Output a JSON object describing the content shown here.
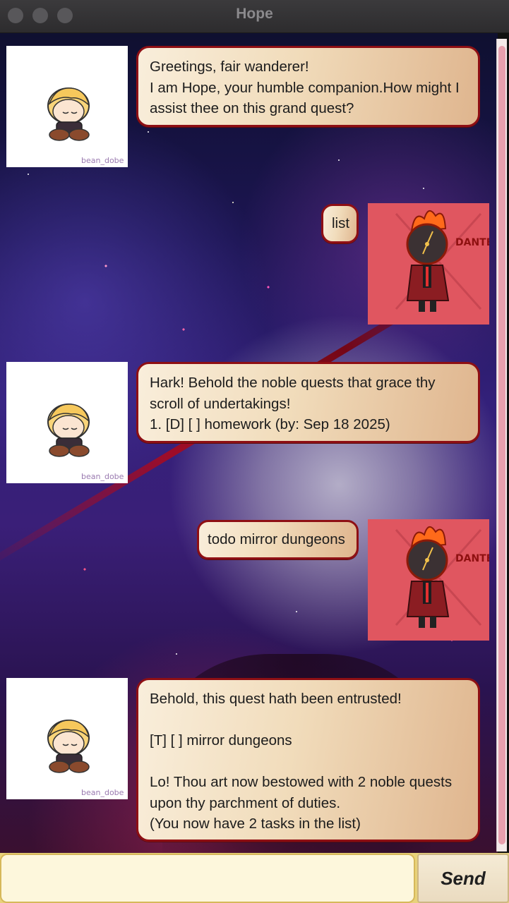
{
  "window": {
    "title": "Hope"
  },
  "messages": [
    {
      "sender": "bot",
      "avatar": "hope-chibi",
      "text": "Greetings, fair wanderer!\nI am Hope, your humble companion.How might I assist thee on this grand quest?"
    },
    {
      "sender": "user",
      "avatar": "dante-clock-head",
      "text": "list"
    },
    {
      "sender": "bot",
      "avatar": "hope-chibi",
      "text": "Hark! Behold the noble quests that grace thy scroll of undertakings!\n1. [D] [ ] homework (by: Sep 18 2025)"
    },
    {
      "sender": "user",
      "avatar": "dante-clock-head",
      "text": "todo mirror dungeons"
    },
    {
      "sender": "bot",
      "avatar": "hope-chibi",
      "text": "Behold, this quest hath been entrusted!\n\n[T] [ ] mirror dungeons\n\nLo! Thou art now bestowed with 2 noble quests upon thy parchment of duties.\n(You now have 2 tasks in the list)"
    }
  ],
  "avatar_text": {
    "hope_signature": "bean_dobe",
    "dante_label": "DANTE"
  },
  "input": {
    "value": "",
    "placeholder": ""
  },
  "send_label": "Send",
  "colors": {
    "bubble_border": "#8e0f14",
    "user_avatar_bg": "#e05660",
    "input_bar": "#e8d27a"
  }
}
